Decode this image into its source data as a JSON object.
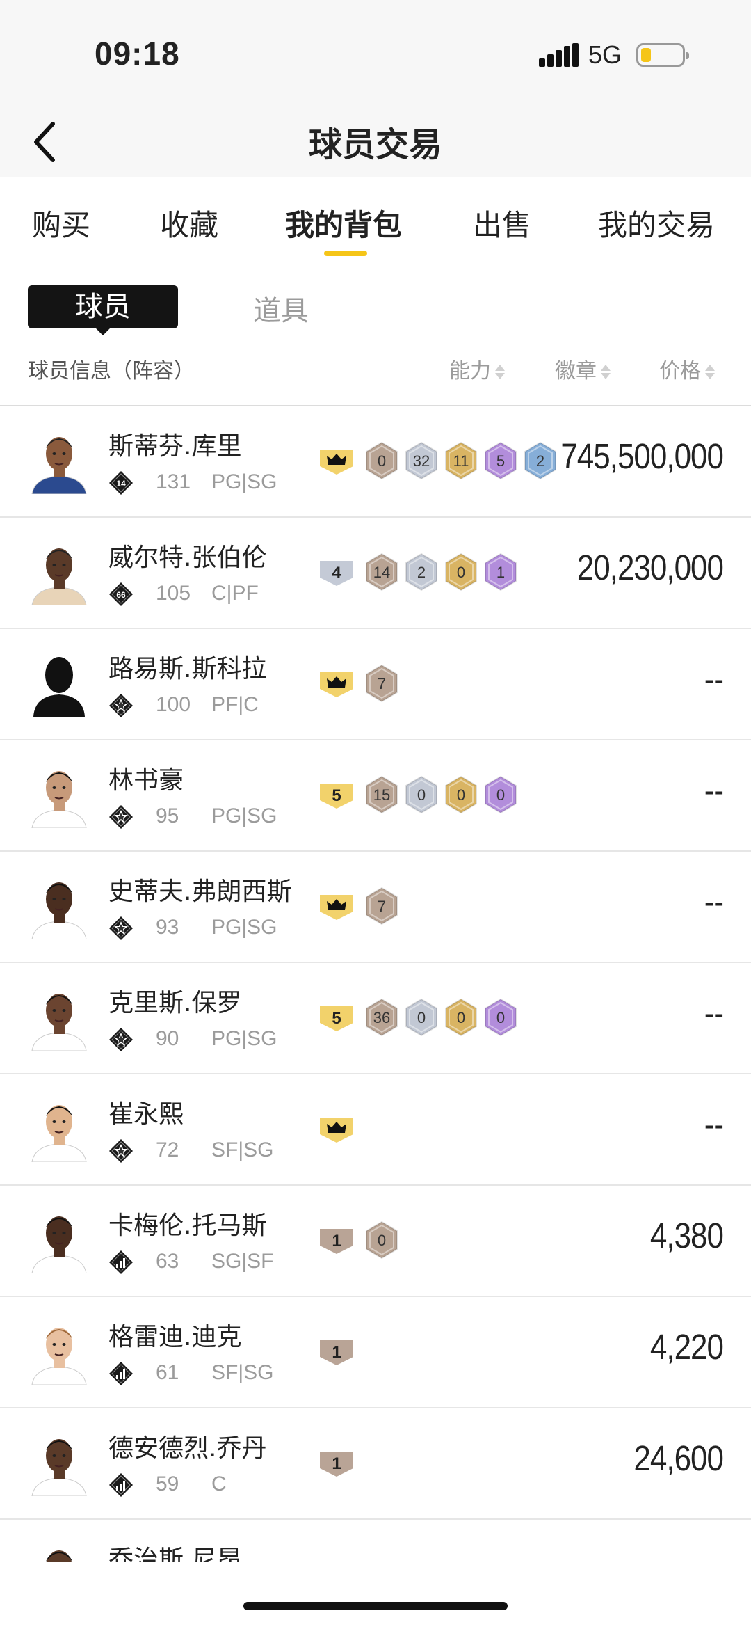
{
  "status_bar": {
    "time": "09:18",
    "network": "5G"
  },
  "header": {
    "title": "球员交易"
  },
  "tabs": [
    "购买",
    "收藏",
    "我的背包",
    "出售",
    "我的交易"
  ],
  "active_tab": "我的背包",
  "segments": {
    "players": "球员",
    "items": "道具"
  },
  "columns": {
    "info": "球员信息（阵容）",
    "ability": "能力",
    "badges": "徽章",
    "price": "价格"
  },
  "colors": {
    "accent": "#f5c518",
    "bronze": "#b8a393",
    "silver": "#c2c8d4",
    "gold": "#d9b463",
    "purple": "#b28ddb",
    "blue": "#86aed8"
  },
  "players": [
    {
      "name": "斯蒂芬.库里",
      "tier": "14",
      "rating": "131",
      "position": "PG|SG",
      "level": "crown",
      "badges": [
        "0",
        "32",
        "11",
        "5",
        "2"
      ],
      "price": "745,500,000"
    },
    {
      "name": "威尔特.张伯伦",
      "tier": "66",
      "rating": "105",
      "position": "C|PF",
      "level": "4",
      "badges": [
        "14",
        "2",
        "0",
        "1"
      ],
      "price": "20,230,000"
    },
    {
      "name": "路易斯.斯科拉",
      "tier": "star",
      "rating": "100",
      "position": "PF|C",
      "level": "crown",
      "badges": [
        "7"
      ],
      "price": "--"
    },
    {
      "name": "林书豪",
      "tier": "star",
      "rating": "95",
      "position": "PG|SG",
      "level": "5",
      "badges": [
        "15",
        "0",
        "0",
        "0"
      ],
      "price": "--"
    },
    {
      "name": "史蒂夫.弗朗西斯",
      "tier": "star",
      "rating": "93",
      "position": "PG|SG",
      "level": "crown",
      "badges": [
        "7"
      ],
      "price": "--"
    },
    {
      "name": "克里斯.保罗",
      "tier": "star",
      "rating": "90",
      "position": "PG|SG",
      "level": "5",
      "badges": [
        "36",
        "0",
        "0",
        "0"
      ],
      "price": "--"
    },
    {
      "name": "崔永熙",
      "tier": "star",
      "rating": "72",
      "position": "SF|SG",
      "level": "crown",
      "badges": [],
      "price": "--"
    },
    {
      "name": "卡梅伦.托马斯",
      "tier": "bars",
      "rating": "63",
      "position": "SG|SF",
      "level": "1",
      "badges": [
        "0"
      ],
      "price": "4,380"
    },
    {
      "name": "格雷迪.迪克",
      "tier": "bars",
      "rating": "61",
      "position": "SF|SG",
      "level": "1",
      "badges": [],
      "price": "4,220"
    },
    {
      "name": "德安德烈.乔丹",
      "tier": "bars",
      "rating": "59",
      "position": "C",
      "level": "1",
      "badges": [],
      "price": "24,600"
    },
    {
      "name": "乔治斯.尼昂",
      "tier": "bars",
      "rating": "",
      "position": "",
      "level": "",
      "badges": [],
      "price": ""
    }
  ]
}
